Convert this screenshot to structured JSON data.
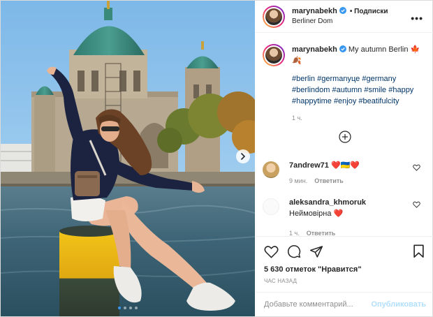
{
  "post": {
    "username": "marynabekh",
    "follow_label": "• Подписки",
    "location": "Berliner Dom",
    "more_label": "•••"
  },
  "caption": {
    "username": "marynabekh",
    "text": "My autumn Berlin 🍁🍂",
    "hashtags": [
      "#berlin",
      "#germanyце",
      "#germany",
      "#berlindom",
      "#autumn",
      "#smile",
      "#happy",
      "#happytime",
      "#enjoy",
      "#beatifulcity"
    ],
    "time": "1 ч."
  },
  "comments": [
    {
      "username": "7andrew71",
      "text": "❤️🇺🇦❤️",
      "time": "9 мин.",
      "reply_label": "Ответить"
    },
    {
      "username": "aleksandra_khmoruk",
      "text": "Неймовірна ❤️",
      "time": "1 ч.",
      "reply_label": "Ответить"
    }
  ],
  "stats": {
    "likes": "5 630 отметок \"Нравится\"",
    "posted": "ЧАС НАЗАД"
  },
  "composer": {
    "placeholder": "Добавьте комментарий...",
    "publish_label": "Опубликовать"
  },
  "carousel": {
    "slides": 4,
    "active_slide": 1
  },
  "icons": [
    "verified-icon",
    "more-icon",
    "load-more-icon",
    "like-icon",
    "comment-icon",
    "share-icon",
    "bookmark-icon",
    "heart-small-icon",
    "next-arrow-icon"
  ],
  "colors": {
    "verified": "#3897f0",
    "link": "#00376b",
    "muted": "#8e8e8e",
    "publish_disabled": "#b2dffc"
  }
}
